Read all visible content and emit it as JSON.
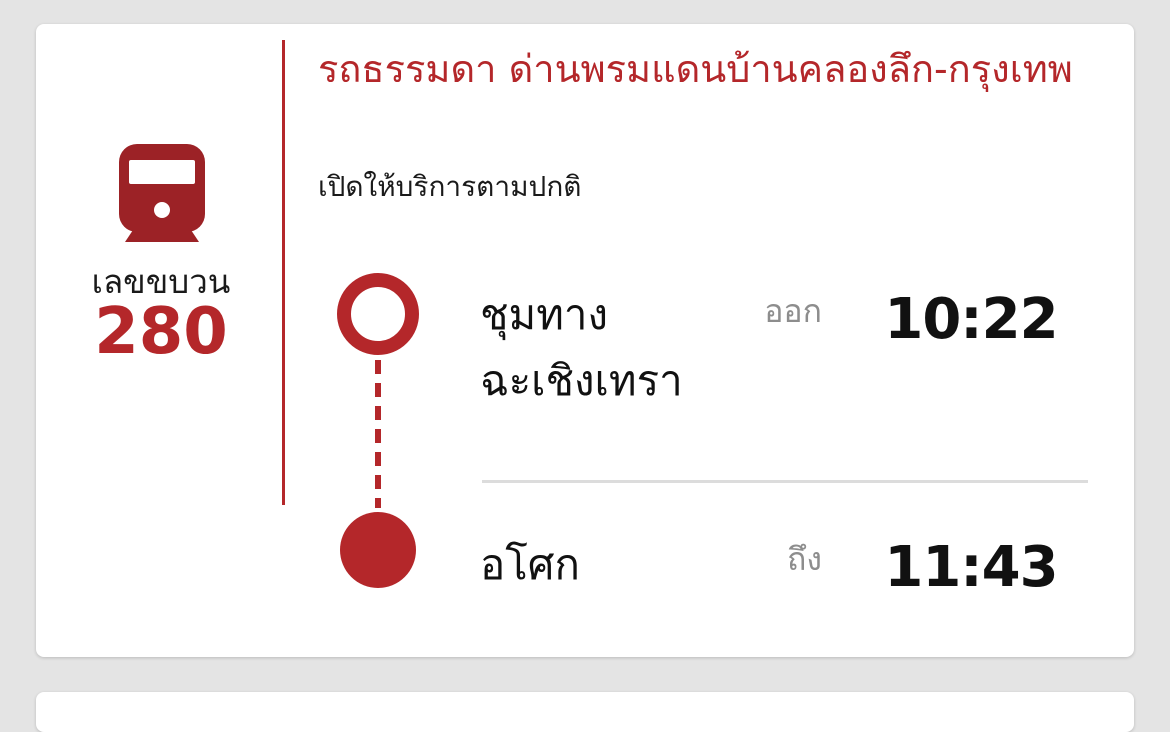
{
  "train": {
    "label": "เลขขบวน",
    "number": "280"
  },
  "route": {
    "title": "รถธรรมดา ด่านพรมแดนบ้านคลองลึก-กรุงเทพ",
    "status": "เปิดให้บริการตามปกติ"
  },
  "origin": {
    "station": "ชุมทางฉะเชิงเทรา",
    "time_label": "ออก",
    "time": "10:22"
  },
  "destination": {
    "station": "อโศก",
    "time_label": "ถึง",
    "time": "11:43"
  },
  "icons": {
    "train": "train-icon",
    "origin_marker": "origin-marker-icon",
    "destination_marker": "destination-marker-icon"
  },
  "colors": {
    "accent": "#b4272a",
    "text": "#111111",
    "muted": "#8d8d8d",
    "divider": "#dcdcdc",
    "background": "#e4e4e4",
    "card": "#ffffff"
  }
}
